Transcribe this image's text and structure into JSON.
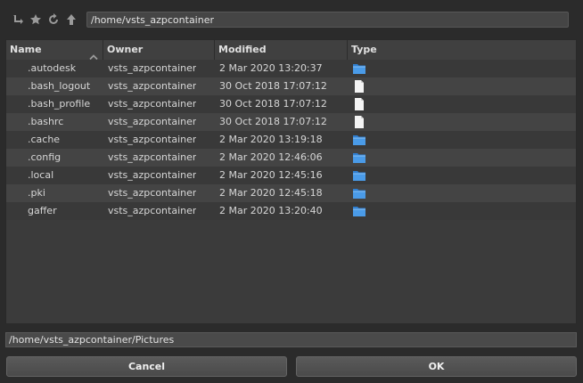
{
  "toolbar": {
    "path": "/home/vsts_azpcontainer",
    "icons": [
      "parent-directory-icon",
      "bookmark-star-icon",
      "refresh-icon",
      "up-arrow-icon"
    ]
  },
  "columns": [
    "Name",
    "Owner",
    "Modified",
    "Type"
  ],
  "sort": {
    "column": "Name",
    "direction": "ascending"
  },
  "files": [
    {
      "name": ".autodesk",
      "owner": "vsts_azpcontainer",
      "modified": "2 Mar 2020 13:20:37",
      "type": "folder"
    },
    {
      "name": ".bash_logout",
      "owner": "vsts_azpcontainer",
      "modified": "30 Oct 2018 17:07:12",
      "type": "file"
    },
    {
      "name": ".bash_profile",
      "owner": "vsts_azpcontainer",
      "modified": "30 Oct 2018 17:07:12",
      "type": "file"
    },
    {
      "name": ".bashrc",
      "owner": "vsts_azpcontainer",
      "modified": "30 Oct 2018 17:07:12",
      "type": "file"
    },
    {
      "name": ".cache",
      "owner": "vsts_azpcontainer",
      "modified": "2 Mar 2020 13:19:18",
      "type": "folder"
    },
    {
      "name": ".config",
      "owner": "vsts_azpcontainer",
      "modified": "2 Mar 2020 12:46:06",
      "type": "folder"
    },
    {
      "name": ".local",
      "owner": "vsts_azpcontainer",
      "modified": "2 Mar 2020 12:45:16",
      "type": "folder"
    },
    {
      "name": ".pki",
      "owner": "vsts_azpcontainer",
      "modified": "2 Mar 2020 12:45:18",
      "type": "folder"
    },
    {
      "name": "gaffer",
      "owner": "vsts_azpcontainer",
      "modified": "2 Mar 2020 13:20:40",
      "type": "folder"
    }
  ],
  "selection_path": "/home/vsts_azpcontainer/Pictures",
  "buttons": {
    "cancel": "Cancel",
    "ok": "OK"
  },
  "colors": {
    "folder": "#2f7fd1",
    "file": "#f4f4f4"
  }
}
